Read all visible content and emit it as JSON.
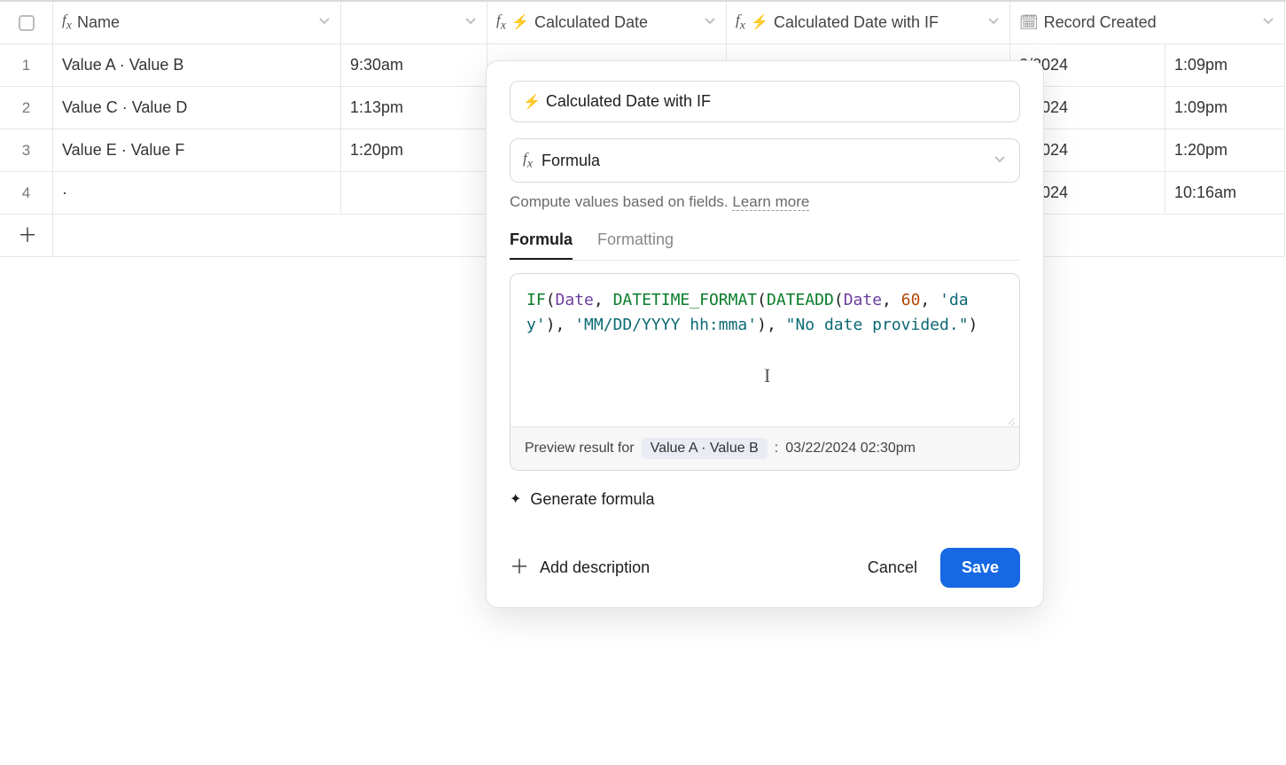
{
  "columns": {
    "name": "Name",
    "blank": "",
    "calc_date": "Calculated Date",
    "calc_date_if": "Calculated Date with IF",
    "record_created": "Record Created"
  },
  "rows": [
    {
      "num": "1",
      "name": "Value A · Value B",
      "time": "9:30am",
      "created_date": "2/2024",
      "created_time": "1:09pm"
    },
    {
      "num": "2",
      "name": "Value C · Value D",
      "time": "1:13pm",
      "created_date": "2/2024",
      "created_time": "1:09pm"
    },
    {
      "num": "3",
      "name": "Value E · Value F",
      "time": "1:20pm",
      "created_date": "2/2024",
      "created_time": "1:20pm"
    },
    {
      "num": "4",
      "name": "·",
      "time": "",
      "created_date": "5/2024",
      "created_time": "10:16am"
    }
  ],
  "editor": {
    "field_name": "Calculated Date with IF",
    "type_label": "Formula",
    "helper_text": "Compute values based on fields. ",
    "learn_more": "Learn more",
    "tabs": {
      "formula": "Formula",
      "formatting": "Formatting"
    },
    "formula_tokens": [
      {
        "t": "fn",
        "v": "IF"
      },
      {
        "t": "p",
        "v": "("
      },
      {
        "t": "fld",
        "v": "Date"
      },
      {
        "t": "p",
        "v": ", "
      },
      {
        "t": "fn",
        "v": "DATETIME_FORMAT"
      },
      {
        "t": "p",
        "v": "("
      },
      {
        "t": "fn",
        "v": "DATEADD"
      },
      {
        "t": "p",
        "v": "("
      },
      {
        "t": "fld",
        "v": "Date"
      },
      {
        "t": "p",
        "v": ", "
      },
      {
        "t": "num",
        "v": "60"
      },
      {
        "t": "p",
        "v": ", "
      },
      {
        "t": "str",
        "v": "'day'"
      },
      {
        "t": "p",
        "v": "), "
      },
      {
        "t": "str",
        "v": "'MM/DD/YYYY hh:mma'"
      },
      {
        "t": "p",
        "v": "), "
      },
      {
        "t": "str",
        "v": "\"No date provided.\""
      },
      {
        "t": "p",
        "v": ")"
      }
    ],
    "preview_label": "Preview result for",
    "preview_record": "Value A · Value B",
    "preview_sep": ":",
    "preview_value": "03/22/2024 02:30pm",
    "generate_label": "Generate formula",
    "add_description": "Add description",
    "cancel": "Cancel",
    "save": "Save"
  }
}
